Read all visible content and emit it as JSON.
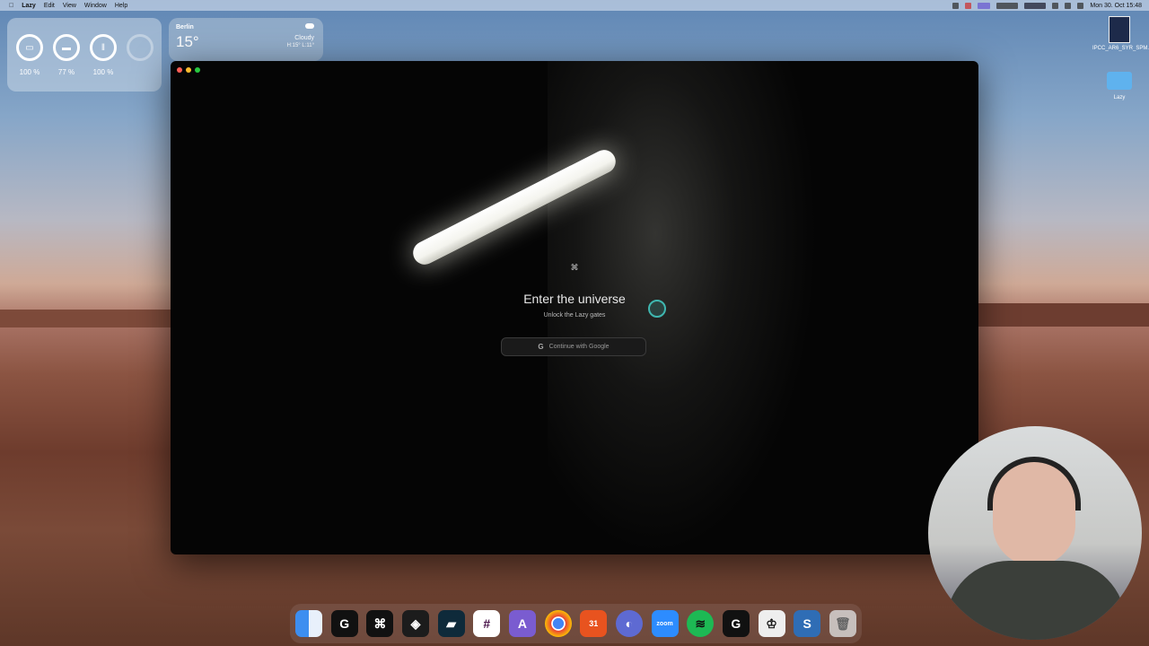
{
  "menubar": {
    "app_name": "Lazy",
    "menus": [
      "Edit",
      "View",
      "Window",
      "Help"
    ],
    "clock": "Mon 30. Oct  15:48"
  },
  "battery_widget": {
    "devices": [
      {
        "icon": "laptop-icon",
        "level": "100 %"
      },
      {
        "icon": "case-icon",
        "level": "77 %"
      },
      {
        "icon": "airpods-icon",
        "level": "100 %"
      }
    ]
  },
  "weather_widget": {
    "city": "Berlin",
    "temperature": "15°",
    "condition": "Cloudy",
    "high_low": "H:15° L:11°"
  },
  "window": {
    "title": "Enter the universe",
    "subtitle": "Unlock the Lazy gates",
    "google_button": "Continue with Google",
    "accent": "#3fb7b0"
  },
  "desktop": {
    "files": [
      {
        "name": "IPCC_AR6_SYR_SPM.pdf"
      },
      {
        "name": "Lazy"
      }
    ]
  },
  "dock": {
    "apps": [
      "Finder",
      "Logitech G",
      "Raycast",
      "Stack",
      "Multi",
      "Slack",
      "Affinity",
      "Chrome",
      "Calendar",
      "Linear",
      "zoom",
      "Spotify",
      "Logitech G Hub",
      "Bartender",
      "Sequel",
      "Trash"
    ],
    "calendar_day": "31",
    "zoom_label": "zoom"
  }
}
